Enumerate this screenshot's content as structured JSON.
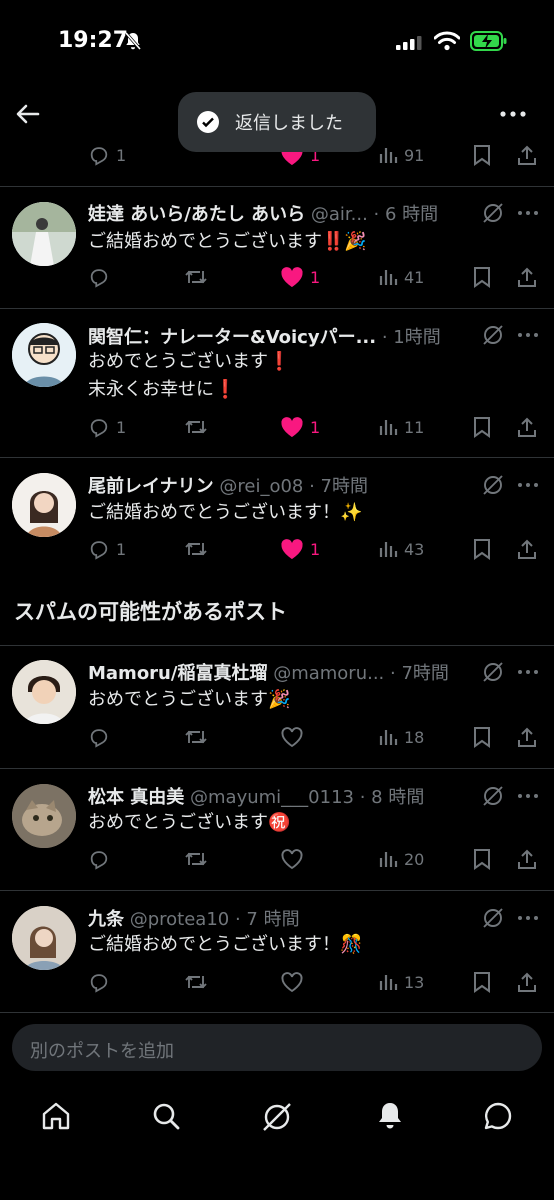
{
  "status_bar": {
    "time": "19:27"
  },
  "toast": {
    "text": "返信しました"
  },
  "top_post_actions": {
    "replies": "1",
    "likes": "1",
    "views": "91"
  },
  "posts": [
    {
      "name": "娃達 あいら/あたし あいら",
      "handle": "@air...",
      "time": "· 6 時間",
      "lines": [
        "ご結婚おめでとうございます‼️🎉"
      ],
      "replies": "",
      "likes": "1",
      "views": "41",
      "liked": true
    },
    {
      "name": "関智仁：ナレーター&Voicyパー...",
      "handle": "",
      "time": "· 1時間",
      "lines": [
        "おめでとうございます❗️",
        "末永くお幸せに❗️"
      ],
      "replies": "1",
      "likes": "1",
      "views": "11",
      "liked": true
    },
    {
      "name": "尾前レイナリン",
      "handle": "@rei_o08",
      "time": "· 7時間",
      "lines": [
        "ご結婚おめでとうございます！✨"
      ],
      "replies": "1",
      "likes": "1",
      "views": "43",
      "liked": true
    }
  ],
  "spam_section_title": "スパムの可能性があるポスト",
  "spam_posts": [
    {
      "name": "Mamoru/稲富真杜瑠",
      "handle": "@mamoru...",
      "time": "· 7時間",
      "lines": [
        "おめでとうございます🎉"
      ],
      "views": "18"
    },
    {
      "name": "松本 真由美",
      "handle": "@mayumi___0113",
      "time": "· 8 時間",
      "lines": [
        "おめでとうございます㊗️"
      ],
      "views": "20"
    },
    {
      "name": "九条",
      "handle": "@protea10",
      "time": "· 7 時間",
      "lines": [
        "ご結婚おめでとうございます！🎊"
      ],
      "views": "13"
    }
  ],
  "reply_bar": {
    "placeholder": "別のポストを追加"
  },
  "colors": {
    "background": "#000000",
    "like": "#f91880",
    "muted": "#71767b",
    "battery": "#32d74b"
  },
  "icons": [
    "back-arrow-icon",
    "more-icon",
    "check-icon",
    "reply-icon",
    "retweet-icon",
    "heart-icon",
    "views-icon",
    "bookmark-icon",
    "share-icon",
    "grok-icon",
    "home-icon",
    "search-icon",
    "bell-icon",
    "chat-icon"
  ]
}
